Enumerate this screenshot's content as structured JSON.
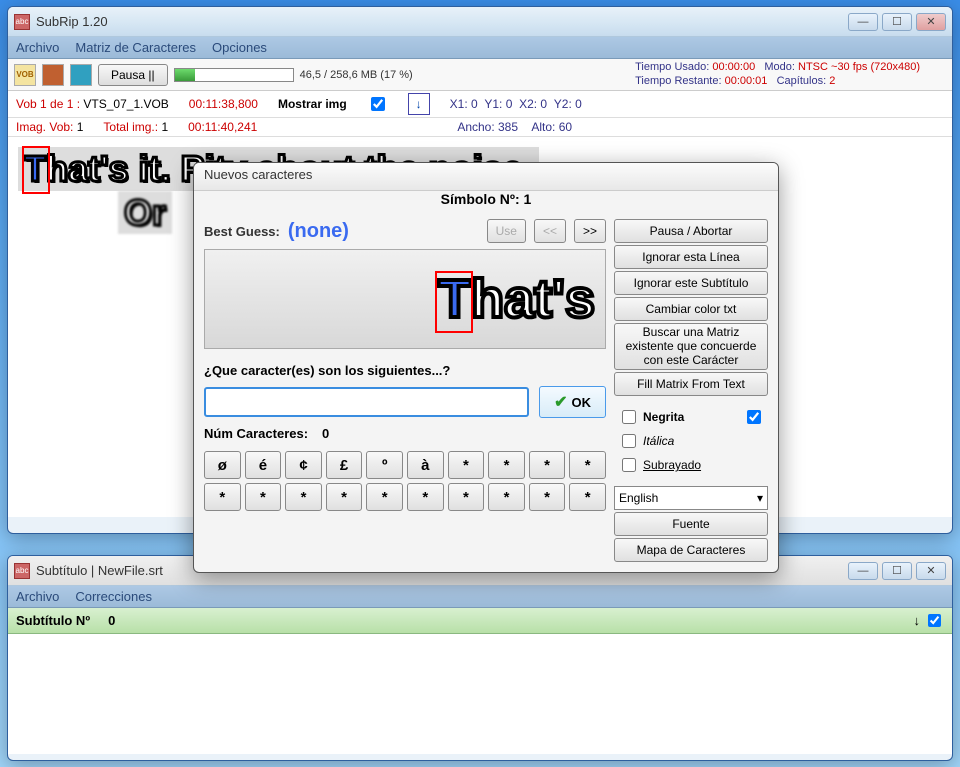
{
  "mainWin": {
    "title": "SubRip 1.20",
    "menu": [
      "Archivo",
      "Matriz de Caracteres",
      "Opciones"
    ],
    "pauseBtn": "Pausa  ||",
    "progressText": "46,5 / 258,6 MB (17 %)",
    "timeUsedLbl": "Tiempo Usado: ",
    "timeUsed": "00:00:00",
    "timeRemLbl": "Tiempo Restante: ",
    "timeRem": "00:00:01",
    "modeLbl": "Modo: ",
    "mode": "NTSC ~30 fps (720x480)",
    "chapLbl": "Capítulos: ",
    "chap": "2",
    "vobLbl": "Vob 1 de 1 :",
    "vobFile": "VTS_07_1.VOB",
    "t1": "00:11:38,800",
    "t2": "00:11:40,241",
    "imgVobLbl": "Imag. Vob:",
    "imgVob": "1",
    "totalImgLbl": "Total img.:",
    "totalImg": "1",
    "mostrarLbl": "Mostrar img",
    "x1": "X1: 0",
    "y1": "Y1: 0",
    "x2": "X2: 0",
    "y2": "Y2: 0",
    "ancho": "Ancho: 385",
    "alto": "Alto: 60",
    "subLine1a": "T",
    "subLine1b": "hat's it. Pity about the noise.",
    "subLine2": "Or"
  },
  "dlg": {
    "title": "Nuevos caracteres",
    "header": "Símbolo Nº: 1",
    "bestGuessLbl": "Best Guess:",
    "bestGuess": "(none)",
    "useBtn": "Use",
    "prevBtn": "<<",
    "nextBtn": ">>",
    "previewA": "T",
    "previewB": "hat's",
    "prompt": "¿Que caracter(es) son los siguientes...?",
    "okBtn": "OK",
    "numLbl": "Núm Caracteres:",
    "numVal": "0",
    "chars": [
      "ø",
      "é",
      "¢",
      "£",
      "º",
      "à",
      "*",
      "*",
      "*",
      "*",
      "*",
      "*",
      "*",
      "*",
      "*",
      "*",
      "*",
      "*",
      "*",
      "*"
    ],
    "side": {
      "pause": "Pausa / Abortar",
      "ignoreLine": "Ignorar esta Línea",
      "ignoreSub": "Ignorar este Subtítulo",
      "cambiar": "Cambiar color txt",
      "buscar": "Buscar una Matriz existente que concuerde con este Carácter",
      "fill": "Fill Matrix From Text",
      "negrita": "Negrita",
      "italica": "Itálica",
      "subrayado": "Subrayado",
      "lang": "English",
      "fuente": "Fuente",
      "mapa": "Mapa de Caracteres"
    }
  },
  "win2": {
    "title": "Subtítulo | NewFile.srt",
    "menu": [
      "Archivo",
      "Correcciones"
    ],
    "rowLbl": "Subtítulo Nº",
    "rowVal": "0"
  }
}
